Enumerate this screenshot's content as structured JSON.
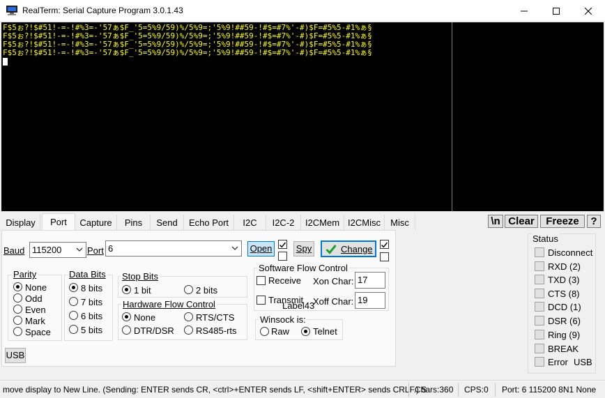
{
  "window": {
    "title": "RealTerm: Serial Capture Program 3.0.1.43"
  },
  "terminal": {
    "lines": [
      "F$5ぉ?!$#51!-=-!#%3=-'57ぁ$F_'5=5%9/59)%/5%9=;'5%9!##59-!#$=#7%'-#)$F=#5%5-#1%ぁ§",
      "F$5ぉ?!$#51!-=-!#%3=-'57ぁ$F_'5=5%9/59)%/5%9=;'5%9!##59-!#$=#7%'-#)$F=#5%5-#1%ぁ§",
      "F$5ぉ?!$#51!-=-!#%3=-'57ぁ$F_'5=5%9/59)%/5%9=;'5%9!##59-!#$=#7%'-#)$F=#5%5-#1%ぁ§",
      "F$5ぉ?!$#51!-=-!#%3=-'57ぁ$F_'5=5%9/59)%/5%9=;'5%9!##59-!#$=#7%'-#)$F=#5%5-#1%ぁ§"
    ],
    "background": "#000000",
    "text_color": "#ffff00"
  },
  "tabs": [
    {
      "label": "Display"
    },
    {
      "label": "Port"
    },
    {
      "label": "Capture"
    },
    {
      "label": "Pins"
    },
    {
      "label": "Send"
    },
    {
      "label": "Echo Port"
    },
    {
      "label": "I2C"
    },
    {
      "label": "I2C-2"
    },
    {
      "label": "I2CMem"
    },
    {
      "label": "I2CMisc"
    },
    {
      "label": "Misc"
    }
  ],
  "active_tab": "Port",
  "toolbar": {
    "newline_label": "\\n",
    "clear_label": "Clear",
    "freeze_label": "Freeze",
    "help_label": "?"
  },
  "port": {
    "baud_label": "Baud",
    "baud_value": "115200",
    "port_label": "Port",
    "port_value": "6",
    "open_label": "Open",
    "spy_label": "Spy",
    "change_label": "Change",
    "usb_label": "USB",
    "parity": {
      "title": "Parity",
      "options": [
        "None",
        "Odd",
        "Even",
        "Mark",
        "Space"
      ],
      "selected": "None"
    },
    "data_bits": {
      "title": "Data Bits",
      "options": [
        "8 bits",
        "7 bits",
        "6 bits",
        "5 bits"
      ],
      "selected": "8 bits"
    },
    "stop_bits": {
      "title": "Stop Bits",
      "options": [
        "1 bit",
        "2 bits"
      ],
      "selected": "1 bit"
    },
    "hw_flow": {
      "title": "Hardware Flow Control",
      "options": [
        "None",
        "RTS/CTS",
        "DTR/DSR",
        "RS485-rts"
      ],
      "selected": "None"
    },
    "sw_flow": {
      "title": "Software Flow Control",
      "receive_label": "Receive",
      "transmit_label": "Transmit",
      "xon_label": "Xon Char:",
      "xon_value": "17",
      "xoff_label": "Xoff Char:",
      "xoff_value": "19",
      "overlay_label": "Label43"
    },
    "winsock": {
      "title": "Winsock is:",
      "options": [
        "Raw",
        "Telnet"
      ],
      "selected": "Telnet"
    }
  },
  "status": {
    "title": "Status",
    "items": [
      "Disconnect",
      "RXD (2)",
      "TXD (3)",
      "CTS (8)",
      "DCD (1)",
      "DSR (6)",
      "Ring (9)",
      "BREAK",
      "Error"
    ],
    "usb_label": "USB"
  },
  "statusbar": {
    "message": "move display to New Line. (Sending: ENTER sends CR, <ctrl>+ENTER sends LF, <shift+ENTER> sends CRLF.) S",
    "chars": "Chars:360",
    "cps": "CPS:0",
    "port_info": "Port: 6  115200 8N1 None"
  },
  "colors": {
    "accent_check": "#1f9e2c",
    "button_highlight": "#cce4f7",
    "panel_bg": "#fafafa"
  }
}
